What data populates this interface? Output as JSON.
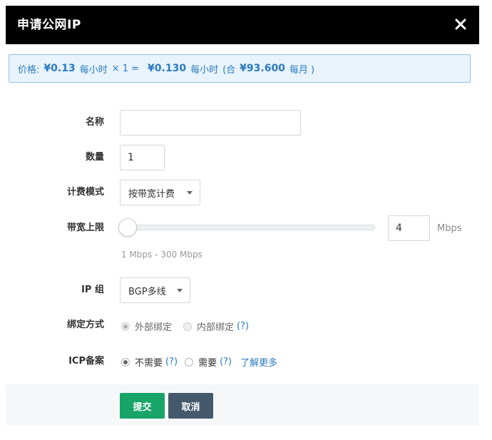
{
  "dialog": {
    "title": "申请公网IP",
    "close_icon": "close-icon"
  },
  "price": {
    "label": "价格:",
    "unit_price": "¥0.13",
    "per_hour": "每小时",
    "multiplier": "× 1 =",
    "total_price": "¥0.130",
    "total_per_hour": "每小时",
    "monthly_open": "(合",
    "monthly_price": "¥93.600",
    "monthly_unit": "每月 )"
  },
  "form": {
    "name": {
      "label": "名称",
      "value": "",
      "placeholder": ""
    },
    "quantity": {
      "label": "数量",
      "value": "1"
    },
    "billing_mode": {
      "label": "计费模式",
      "selected": "按带宽计费"
    },
    "bandwidth": {
      "label": "带宽上限",
      "value": "4",
      "unit": "Mbps",
      "range_hint": "1 Mbps - 300 Mbps",
      "slider_min": 1,
      "slider_max": 300,
      "slider_value": 4
    },
    "ip_group": {
      "label": "IP 组",
      "selected": "BGP多线"
    },
    "binding": {
      "label": "绑定方式",
      "options": [
        {
          "label": "外部绑定",
          "checked": true,
          "disabled": true
        },
        {
          "label": "内部绑定",
          "checked": false,
          "disabled": true
        }
      ],
      "help": "(?)"
    },
    "icp": {
      "label": "ICP备案",
      "options": [
        {
          "label": "不需要",
          "checked": true,
          "help": "(?)"
        },
        {
          "label": "需要",
          "checked": false,
          "help": "(?)"
        }
      ],
      "learn_more": "了解更多"
    }
  },
  "footer": {
    "submit_label": "提交",
    "cancel_label": "取消"
  },
  "colors": {
    "title_bar": "#000000",
    "price_text": "#2a7bbf",
    "price_bg": "#e8f3fb",
    "submit": "#18a469",
    "cancel": "#445a6c"
  }
}
